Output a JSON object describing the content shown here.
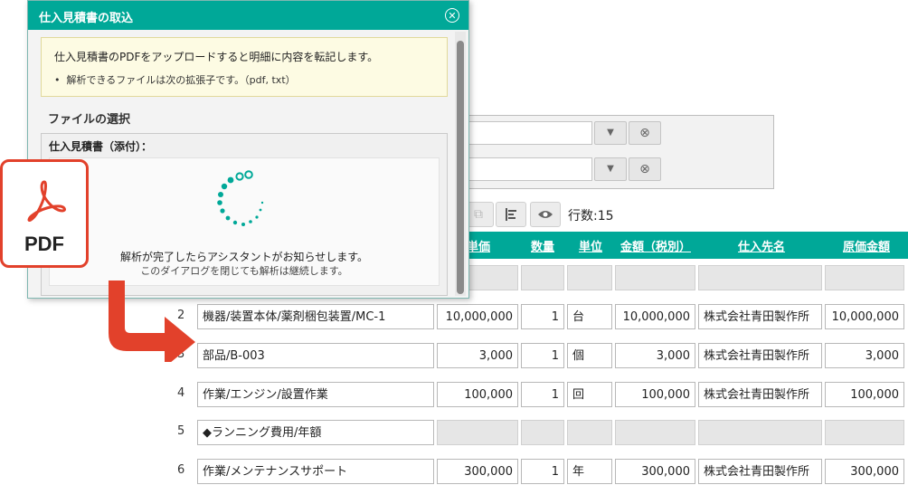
{
  "dialog": {
    "title": "仕入見積書の取込",
    "notice_main": "仕入見積書のPDFをアップロードすると明細に内容を転記します。",
    "notice_bullet": "解析できるファイルは次の拡張子です。（pdf, txt）",
    "section_title": "ファイルの選択",
    "attach_label": "仕入見積書（添付）：",
    "status_line1": "解析が完了したらアシスタントがお知らせします。",
    "status_line2": "このダイアログを閉じても解析は継続します。"
  },
  "pdf_icon": {
    "label": "PDF",
    "color": "#e2412b"
  },
  "toolbar": {
    "row_count": "行数:15"
  },
  "grid": {
    "headers": [
      "単価",
      "数量",
      "単位",
      "金額（税別）",
      "仕入先名",
      "原価金額"
    ],
    "rows": [
      {
        "no": "2",
        "item": "機器/装置本体/薬剤梱包装置/MC-1",
        "unit_price": "10,000,000",
        "qty": "1",
        "unit": "台",
        "amount": "10,000,000",
        "supplier": "株式会社青田製作所",
        "cost": "10,000,000"
      },
      {
        "no": "3",
        "item": "部品/B-003",
        "unit_price": "3,000",
        "qty": "1",
        "unit": "個",
        "amount": "3,000",
        "supplier": "株式会社青田製作所",
        "cost": "3,000"
      },
      {
        "no": "4",
        "item": "作業/エンジン/設置作業",
        "unit_price": "100,000",
        "qty": "1",
        "unit": "回",
        "amount": "100,000",
        "supplier": "株式会社青田製作所",
        "cost": "100,000"
      },
      {
        "no": "5",
        "item": "◆ランニング費用/年額",
        "unit_price": "",
        "qty": "",
        "unit": "",
        "amount": "",
        "supplier": "",
        "cost": ""
      },
      {
        "no": "6",
        "item": "作業/メンテナンスサポート",
        "unit_price": "300,000",
        "qty": "1",
        "unit": "年",
        "amount": "300,000",
        "supplier": "株式会社青田製作所",
        "cost": "300,000"
      }
    ]
  },
  "colors": {
    "accent": "#00a898",
    "arrow": "#e2412b",
    "notice_bg": "#fdfbe3"
  }
}
